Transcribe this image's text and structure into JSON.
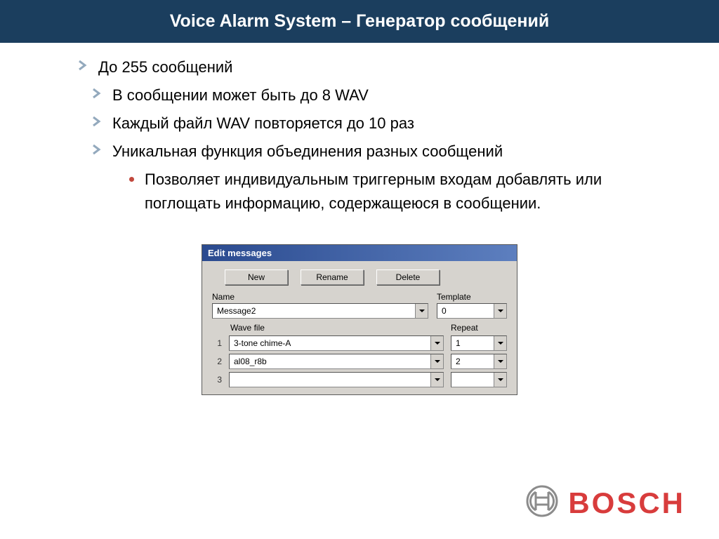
{
  "title": "Voice Alarm System – Генератор сообщений",
  "bullets": {
    "b1": "До 255 сообщений",
    "b2": "В сообщении может быть до 8 WAV",
    "b3": "Каждый файл WAV повторяется до 10 раз",
    "b4": "Уникальная функция объединения разных сообщений",
    "b5": "Позволяет индивидуальным триггерным входам добавлять или поглощать информацию, содержащеюся в сообщении."
  },
  "dialog": {
    "title": "Edit messages",
    "buttons": {
      "new": "New",
      "rename": "Rename",
      "delete": "Delete"
    },
    "labels": {
      "name": "Name",
      "template": "Template",
      "wave": "Wave file",
      "repeat": "Repeat"
    },
    "name_value": "Message2",
    "template_value": "0",
    "rows": [
      {
        "idx": "1",
        "file": "3-tone chime-A",
        "repeat": "1"
      },
      {
        "idx": "2",
        "file": "al08_r8b",
        "repeat": "2"
      },
      {
        "idx": "3",
        "file": "",
        "repeat": ""
      }
    ]
  },
  "footer": {
    "brand": "BOSCH"
  }
}
